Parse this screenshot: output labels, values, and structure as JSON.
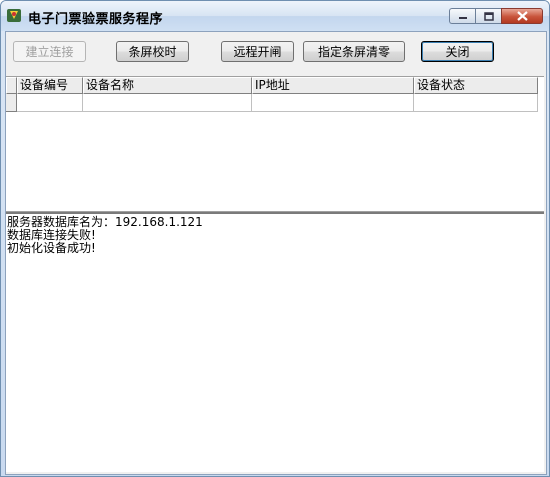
{
  "window": {
    "title": "电子门票验票服务程序",
    "controls": {
      "minimize_icon": "minimize-icon",
      "maximize_icon": "maximize-icon",
      "close_icon": "close-icon"
    }
  },
  "toolbar": {
    "connect_label": "建立连接",
    "sync_time_label": "条屏校时",
    "remote_open_label": "远程开闸",
    "clear_label": "指定条屏清零",
    "close_label": "关闭"
  },
  "grid": {
    "columns": [
      "设备编号",
      "设备名称",
      "IP地址",
      "设备状态"
    ],
    "rows": []
  },
  "log": {
    "lines": [
      "服务器数据库名为：192.168.1.121",
      "数据库连接失败!",
      "初始化设备成功!"
    ]
  },
  "colors": {
    "title_bar": "#d7e4f3",
    "close_button": "#c8543b",
    "client_bg": "#f0f0f0"
  }
}
